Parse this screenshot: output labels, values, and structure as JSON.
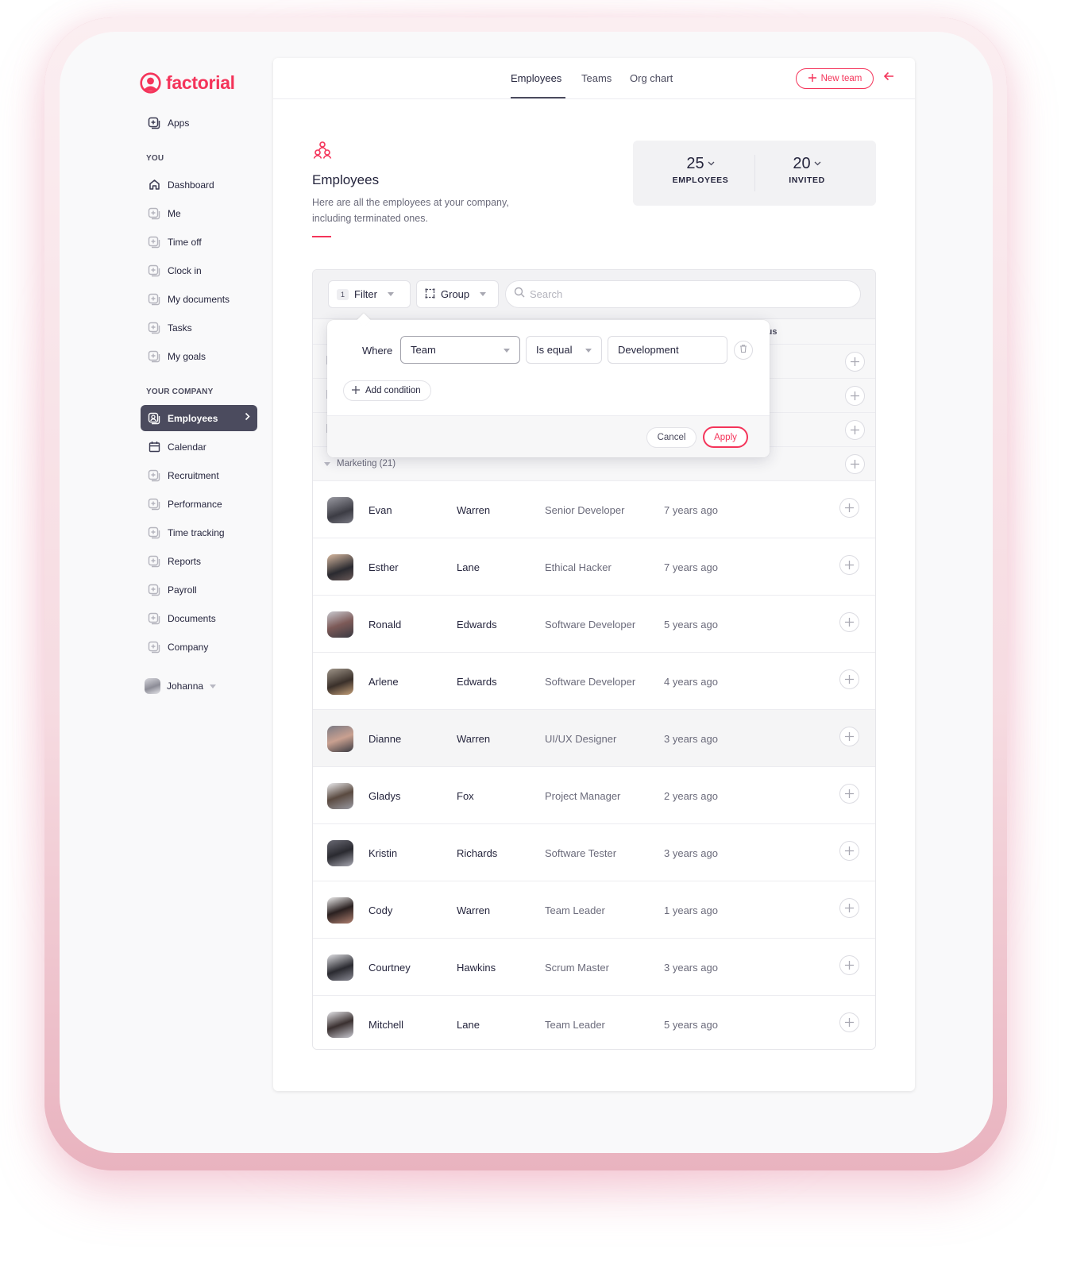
{
  "brand": {
    "name": "factorial",
    "accent_color": "#f4345a",
    "dark_color": "#4b4b5e"
  },
  "sidebar": {
    "apps_label": "Apps",
    "sections": [
      {
        "title": "YOU",
        "items": [
          {
            "label": "Dashboard",
            "icon": "home-icon"
          },
          {
            "label": "Me",
            "icon": "app-icon"
          },
          {
            "label": "Time off",
            "icon": "app-icon"
          },
          {
            "label": "Clock in",
            "icon": "app-icon"
          },
          {
            "label": "My documents",
            "icon": "app-icon"
          },
          {
            "label": "Tasks",
            "icon": "app-icon"
          },
          {
            "label": "My goals",
            "icon": "app-icon"
          }
        ]
      },
      {
        "title": "YOUR COMPANY",
        "items": [
          {
            "label": "Employees",
            "icon": "user-icon",
            "active": true
          },
          {
            "label": "Calendar",
            "icon": "calendar-icon"
          },
          {
            "label": "Recruitment",
            "icon": "app-icon"
          },
          {
            "label": "Performance",
            "icon": "app-icon"
          },
          {
            "label": "Time tracking",
            "icon": "app-icon"
          },
          {
            "label": "Reports",
            "icon": "app-icon"
          },
          {
            "label": "Payroll",
            "icon": "app-icon"
          },
          {
            "label": "Documents",
            "icon": "app-icon"
          },
          {
            "label": "Company",
            "icon": "app-icon"
          }
        ]
      }
    ],
    "user": {
      "name": "Johanna"
    }
  },
  "topnav": {
    "tabs": [
      {
        "label": "Employees",
        "active": true
      },
      {
        "label": "Teams",
        "active": false
      },
      {
        "label": "Org chart",
        "active": false
      }
    ],
    "new_team_label": "New team"
  },
  "header": {
    "title": "Employees",
    "description": "Here are all the employees at your company, including terminated ones.",
    "stats": [
      {
        "value": "25",
        "label": "EMPLOYEES"
      },
      {
        "value": "20",
        "label": "INVITED"
      }
    ]
  },
  "toolbar": {
    "filter_count": "1",
    "filter_label": "Filter",
    "group_label": "Group",
    "search_placeholder": "Search",
    "search_value": ""
  },
  "table": {
    "status_header_fragment": "tus",
    "group": {
      "label": "Marketing (21)"
    },
    "rows": [
      {
        "first": "Evan",
        "last": "Warren",
        "role": "Senior Developer",
        "since": "7 years ago"
      },
      {
        "first": "Esther",
        "last": "Lane",
        "role": "Ethical Hacker",
        "since": "7 years ago"
      },
      {
        "first": "Ronald",
        "last": "Edwards",
        "role": "Software Developer",
        "since": "5 years ago"
      },
      {
        "first": "Arlene",
        "last": "Edwards",
        "role": "Software Developer",
        "since": "4 years ago"
      },
      {
        "first": "Dianne",
        "last": "Warren",
        "role": "UI/UX Designer",
        "since": "3 years ago",
        "hover": true
      },
      {
        "first": "Gladys",
        "last": "Fox",
        "role": "Project Manager",
        "since": "2 years ago"
      },
      {
        "first": "Kristin",
        "last": "Richards",
        "role": "Software Tester",
        "since": "3 years ago"
      },
      {
        "first": "Cody",
        "last": "Warren",
        "role": "Team Leader",
        "since": "1 years ago"
      },
      {
        "first": "Courtney",
        "last": "Hawkins",
        "role": "Scrum Master",
        "since": "3 years ago"
      },
      {
        "first": "Mitchell",
        "last": "Lane",
        "role": "Team Leader",
        "since": "5 years ago"
      }
    ]
  },
  "filter_popover": {
    "where_label": "Where",
    "field": "Team",
    "operator": "Is equal",
    "value": "Development",
    "add_condition_label": "Add condition",
    "cancel_label": "Cancel",
    "apply_label": "Apply"
  }
}
